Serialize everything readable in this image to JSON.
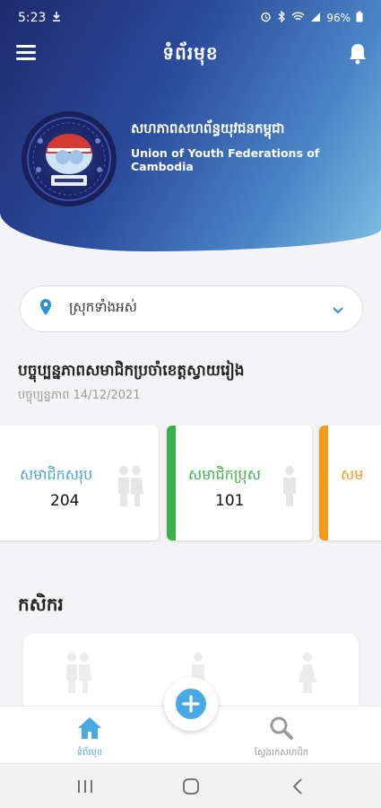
{
  "status_bar": {
    "time": "5:23",
    "battery": "96%"
  },
  "app_bar": {
    "title": "ទំព័រមុខ",
    "menu_icon": "hamburger-menu-icon",
    "bell_icon": "bell-icon"
  },
  "organization": {
    "name_km": "សហភាពសហព័ន្ធយុវជនកម្ពុជា",
    "name_en": "Union of Youth Federations of Cambodia"
  },
  "filter": {
    "value": "ស្រុកទាំងអស់",
    "icon": "location-pin-icon"
  },
  "summary": {
    "title": "បច្ចុប្បន្នភាពសមាជិកប្រចាំខេត្តស្វាយរៀង",
    "updated": "បច្ចុប្បន្នភាព 14/12/2021"
  },
  "stats": [
    {
      "label": "សមាជិកសរុប",
      "value": "204",
      "color": "#4a9fd8"
    },
    {
      "label": "សមាជិកប្រុស",
      "value": "101",
      "color": "#3cae4a"
    },
    {
      "label": "សម",
      "value": "",
      "color": "#f39a1a"
    }
  ],
  "category": {
    "title": "កសិករ"
  },
  "bottom_nav": {
    "home_label": "ទំព័រមុខ",
    "search_label": "ស្វែងរកសមាជិក",
    "accent": "#4aa8e2"
  }
}
